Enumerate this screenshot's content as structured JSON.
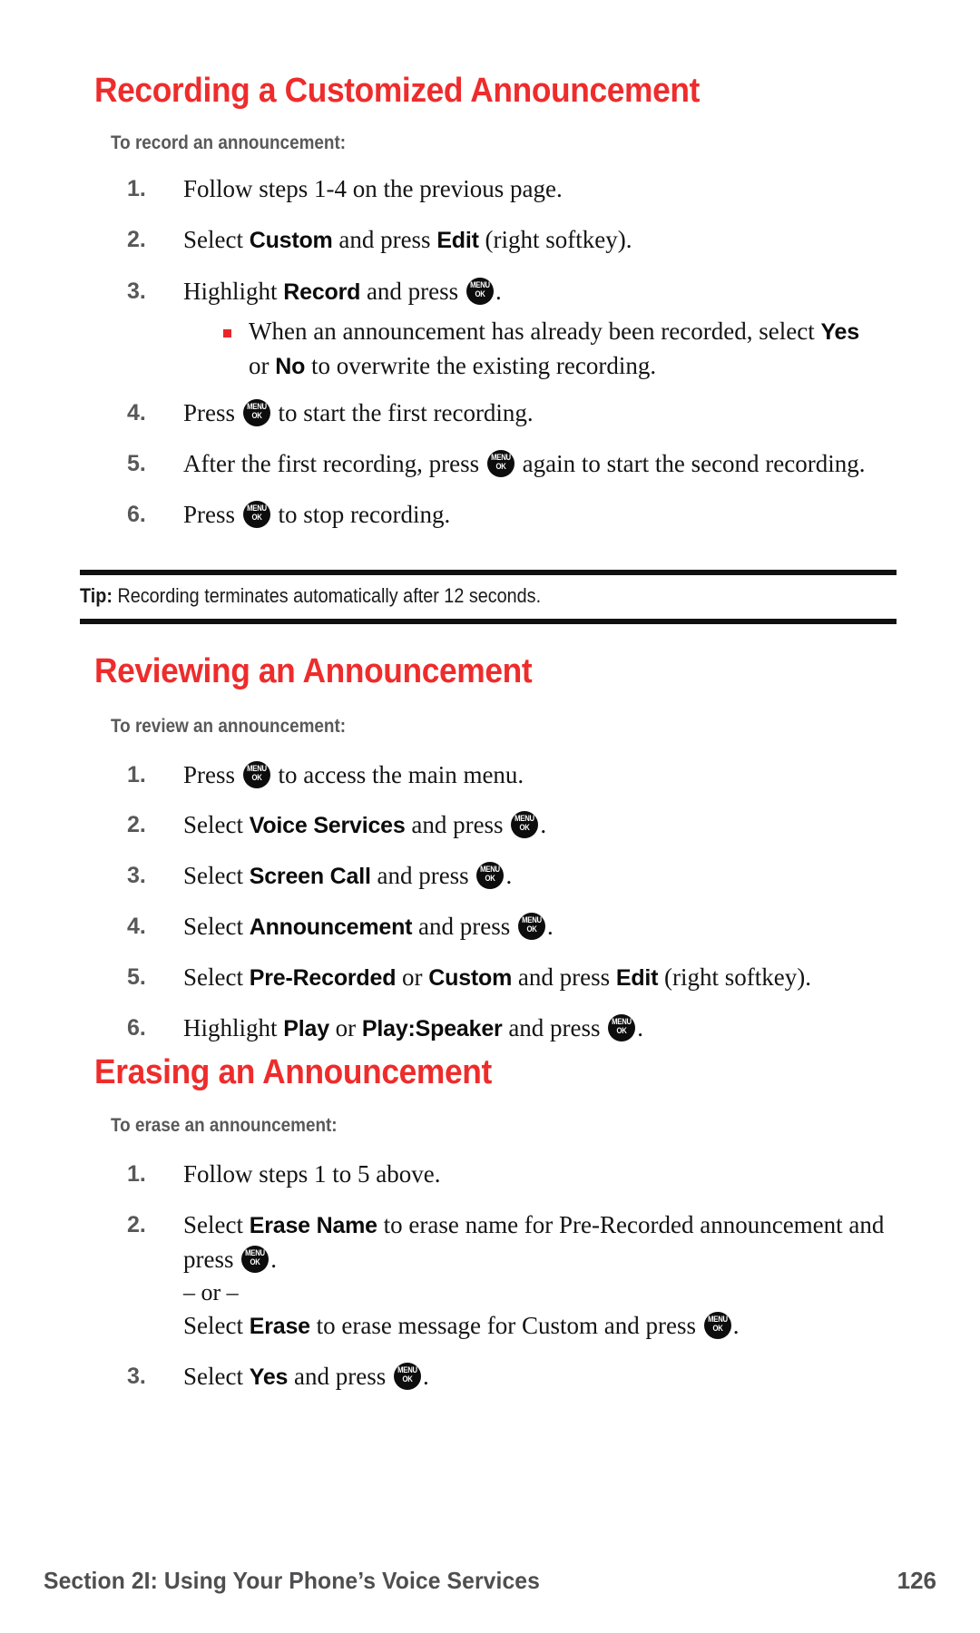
{
  "document": {
    "type": "phone-user-guide-page",
    "accent_color": "#ee2c2c",
    "subheading_color": "#595959",
    "body_color": "#141414",
    "footer_color": "#4f4f51"
  },
  "icons": {
    "menu_ok": {
      "name": "menu-ok-key-icon",
      "top": "MENU",
      "bottom": "OK"
    },
    "square_bullet": {
      "name": "square-bullet-icon",
      "color": "#e8262a"
    }
  },
  "sections": [
    {
      "heading": "Recording a Customized Announcement",
      "subheading": "To record an announcement:",
      "steps": [
        {
          "number": "1.",
          "parts": [
            {
              "t": "text",
              "v": "Follow steps 1-4 on the previous page."
            }
          ]
        },
        {
          "number": "2.",
          "parts": [
            {
              "t": "text",
              "v": "Select "
            },
            {
              "t": "kw",
              "v": "Custom"
            },
            {
              "t": "text",
              "v": " and press "
            },
            {
              "t": "kw",
              "v": "Edit"
            },
            {
              "t": "text",
              "v": " (right softkey)."
            }
          ]
        },
        {
          "number": "3.",
          "parts": [
            {
              "t": "text",
              "v": "Highlight "
            },
            {
              "t": "kw",
              "v": "Record"
            },
            {
              "t": "text",
              "v": " and press "
            },
            {
              "t": "key",
              "v": "menu_ok"
            },
            {
              "t": "text",
              "v": "."
            }
          ],
          "subbullets": [
            {
              "parts": [
                {
                  "t": "text",
                  "v": "When an announcement has already been recorded, select "
                },
                {
                  "t": "kw",
                  "v": "Yes"
                },
                {
                  "t": "text",
                  "v": " or "
                },
                {
                  "t": "kw",
                  "v": "No"
                },
                {
                  "t": "text",
                  "v": " to overwrite the existing recording."
                }
              ]
            }
          ]
        },
        {
          "number": "4.",
          "parts": [
            {
              "t": "text",
              "v": "Press "
            },
            {
              "t": "key",
              "v": "menu_ok"
            },
            {
              "t": "text",
              "v": " to start the first recording."
            }
          ]
        },
        {
          "number": "5.",
          "parts": [
            {
              "t": "text",
              "v": "After the first recording, press "
            },
            {
              "t": "key",
              "v": "menu_ok"
            },
            {
              "t": "text",
              "v": " again to start the second recording."
            }
          ]
        },
        {
          "number": "6.",
          "parts": [
            {
              "t": "text",
              "v": "Press "
            },
            {
              "t": "key",
              "v": "menu_ok"
            },
            {
              "t": "text",
              "v": " to stop recording."
            }
          ]
        }
      ],
      "tip": {
        "label": "Tip:",
        "text": "Recording terminates automatically after 12 seconds."
      }
    },
    {
      "heading": "Reviewing an Announcement",
      "subheading": "To review an announcement:",
      "steps": [
        {
          "number": "1.",
          "parts": [
            {
              "t": "text",
              "v": "Press "
            },
            {
              "t": "key",
              "v": "menu_ok"
            },
            {
              "t": "text",
              "v": " to access the main menu."
            }
          ]
        },
        {
          "number": "2.",
          "parts": [
            {
              "t": "text",
              "v": "Select "
            },
            {
              "t": "kw",
              "v": "Voice Services"
            },
            {
              "t": "text",
              "v": " and press "
            },
            {
              "t": "key",
              "v": "menu_ok"
            },
            {
              "t": "text",
              "v": "."
            }
          ]
        },
        {
          "number": "3.",
          "parts": [
            {
              "t": "text",
              "v": "Select "
            },
            {
              "t": "kw",
              "v": "Screen Call"
            },
            {
              "t": "text",
              "v": " and press "
            },
            {
              "t": "key",
              "v": "menu_ok"
            },
            {
              "t": "text",
              "v": "."
            }
          ]
        },
        {
          "number": "4.",
          "parts": [
            {
              "t": "text",
              "v": "Select "
            },
            {
              "t": "kw",
              "v": "Announcement"
            },
            {
              "t": "text",
              "v": " and press "
            },
            {
              "t": "key",
              "v": "menu_ok"
            },
            {
              "t": "text",
              "v": "."
            }
          ]
        },
        {
          "number": "5.",
          "parts": [
            {
              "t": "text",
              "v": "Select "
            },
            {
              "t": "kw",
              "v": "Pre-Recorded"
            },
            {
              "t": "text",
              "v": " or "
            },
            {
              "t": "kw",
              "v": "Custom"
            },
            {
              "t": "text",
              "v": " and press "
            },
            {
              "t": "kw",
              "v": "Edit"
            },
            {
              "t": "text",
              "v": " (right softkey)."
            }
          ]
        },
        {
          "number": "6.",
          "parts": [
            {
              "t": "text",
              "v": "Highlight "
            },
            {
              "t": "kw",
              "v": "Play"
            },
            {
              "t": "text",
              "v": " or "
            },
            {
              "t": "kw",
              "v": "Play:Speaker"
            },
            {
              "t": "text",
              "v": " and press "
            },
            {
              "t": "key",
              "v": "menu_ok"
            },
            {
              "t": "text",
              "v": "."
            }
          ]
        }
      ]
    },
    {
      "heading": "Erasing an Announcement",
      "subheading": "To erase an announcement:",
      "steps": [
        {
          "number": "1.",
          "parts": [
            {
              "t": "text",
              "v": "Follow steps 1 to 5 above."
            }
          ]
        },
        {
          "number": "2.",
          "parts": [
            {
              "t": "text",
              "v": "Select "
            },
            {
              "t": "kw",
              "v": "Erase Name"
            },
            {
              "t": "text",
              "v": " to erase name for Pre-Recorded announcement and press "
            },
            {
              "t": "key",
              "v": "menu_ok"
            },
            {
              "t": "text",
              "v": "."
            }
          ],
          "alt_separator": "– or –",
          "alt_parts": [
            {
              "t": "text",
              "v": "Select "
            },
            {
              "t": "kw",
              "v": "Erase"
            },
            {
              "t": "text",
              "v": " to erase message for Custom and press "
            },
            {
              "t": "key",
              "v": "menu_ok"
            },
            {
              "t": "text",
              "v": "."
            }
          ]
        },
        {
          "number": "3.",
          "parts": [
            {
              "t": "text",
              "v": "Select "
            },
            {
              "t": "kw",
              "v": "Yes"
            },
            {
              "t": "text",
              "v": " and press "
            },
            {
              "t": "key",
              "v": "menu_ok"
            },
            {
              "t": "text",
              "v": "."
            }
          ]
        }
      ]
    }
  ],
  "footer": {
    "title": "Section 2I: Using Your Phone’s Voice Services",
    "page_number": "126"
  }
}
